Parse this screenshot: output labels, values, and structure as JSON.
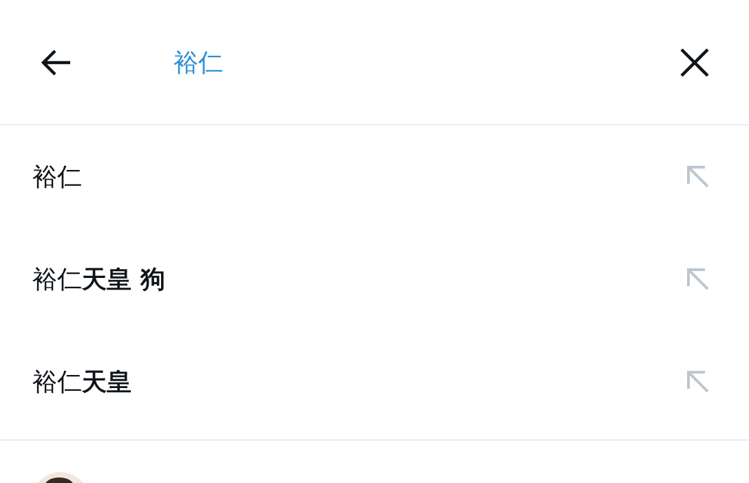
{
  "search": {
    "value": "裕仁"
  },
  "suggestions": [
    {
      "text": "裕仁"
    },
    {
      "text": "裕仁**天皇 狗**"
    },
    {
      "text": "裕仁**天皇**"
    }
  ]
}
